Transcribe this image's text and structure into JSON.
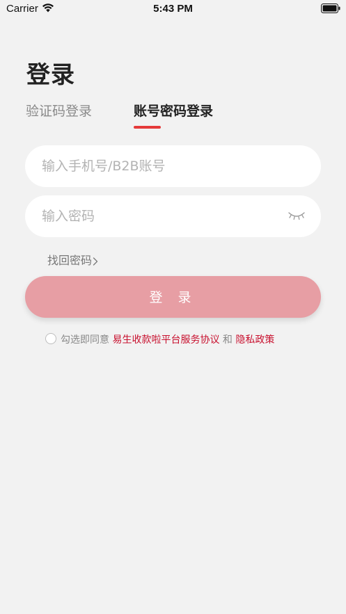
{
  "status_bar": {
    "carrier": "Carrier",
    "time": "5:43 PM",
    "wifi_icon": "wifi-icon",
    "battery_icon": "battery-icon"
  },
  "page": {
    "title": "登录"
  },
  "tabs": [
    {
      "label": "验证码登录",
      "active": false
    },
    {
      "label": "账号密码登录",
      "active": true
    }
  ],
  "account_field": {
    "value": "",
    "placeholder": "输入手机号/B2B账号"
  },
  "password_field": {
    "value": "",
    "placeholder": "输入密码",
    "toggle_icon": "eye-closed-icon"
  },
  "forgot": {
    "label": "找回密码",
    "icon": "chevron-right-icon"
  },
  "login_button": {
    "label": "登 录"
  },
  "agreement": {
    "checked": false,
    "prefix": "勾选即同意",
    "service_link": "易生收款啦平台服务协议",
    "and": "和",
    "privacy_link": "隐私政策"
  },
  "colors": {
    "background": "#f2f2f2",
    "accent": "#e53a3a",
    "button": "#e79ea4",
    "link": "#c8102e"
  }
}
